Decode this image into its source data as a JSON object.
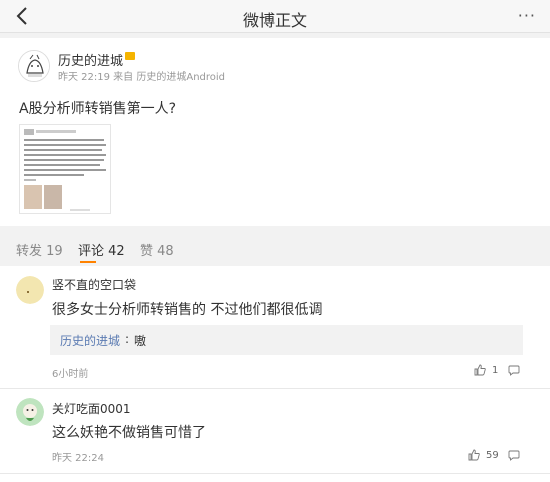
{
  "nav": {
    "title": "微博正文",
    "more_glyph": "···"
  },
  "post": {
    "author": "历史的进城",
    "meta": "昨天 22:19 来自 历史的进城Android",
    "text": "A股分析师转销售第一人?"
  },
  "tabs": [
    {
      "label": "转发 19"
    },
    {
      "label": "评论 42"
    },
    {
      "label": "赞 48"
    }
  ],
  "comments": [
    {
      "name": "竖不直的空口袋",
      "text": "很多女士分析师转销售的 不过他们都很低调",
      "reply": {
        "name": "历史的进城",
        "colon": ":",
        "text": "嗷"
      },
      "time": "6小时前",
      "likes": "1"
    },
    {
      "name": "关灯吃面0001",
      "text": "这么妖艳不做销售可惜了",
      "time": "昨天 22:24",
      "likes": "59"
    }
  ],
  "colors": {
    "accent": "#ff8200",
    "link": "#5b7bb2"
  }
}
